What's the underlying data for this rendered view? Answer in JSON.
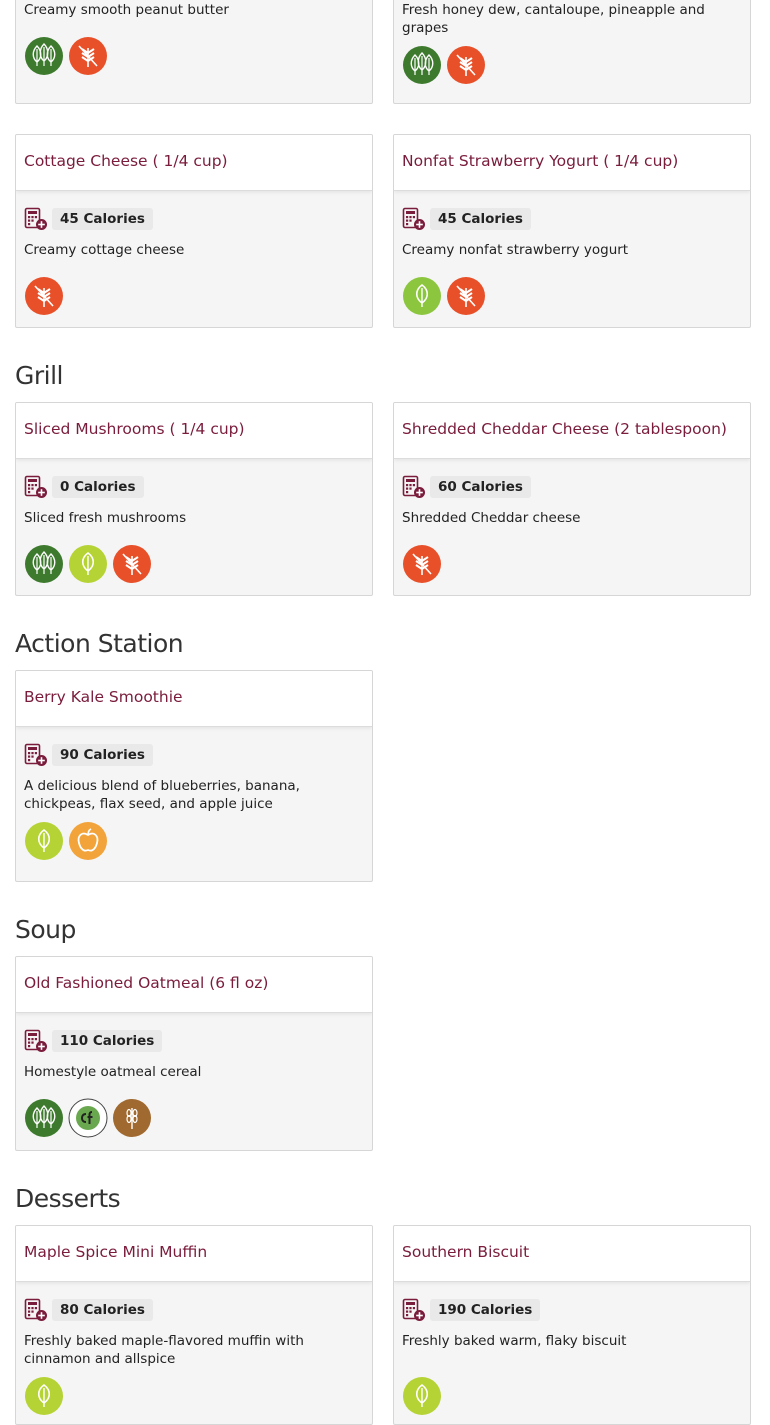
{
  "sections": {
    "grill": {
      "title": "Grill"
    },
    "action_station": {
      "title": "Action Station"
    },
    "soup": {
      "title": "Soup"
    },
    "desserts": {
      "title": "Desserts"
    }
  },
  "items": [
    {
      "name": "",
      "calories": "",
      "description": "Creamy smooth peanut butter",
      "badges": [
        "vegan",
        "no-gluten"
      ]
    },
    {
      "name": "",
      "calories": "",
      "description": "Fresh honey dew, cantaloupe, pineapple and grapes",
      "badges": [
        "vegan",
        "no-gluten"
      ]
    },
    {
      "name": "Cottage Cheese ( 1/4 cup)",
      "calories": "45 Calories",
      "description": "Creamy cottage cheese",
      "badges": [
        "no-gluten"
      ]
    },
    {
      "name": "Nonfat Strawberry Yogurt ( 1/4 cup)",
      "calories": "45 Calories",
      "description": "Creamy nonfat strawberry yogurt",
      "badges": [
        "vegetarian",
        "no-gluten"
      ]
    },
    {
      "name": "Sliced Mushrooms ( 1/4 cup)",
      "calories": "0 Calories",
      "description": "Sliced fresh mushrooms",
      "badges": [
        "vegan",
        "plant-forward",
        "no-gluten"
      ]
    },
    {
      "name": "Shredded Cheddar Cheese (2 tablespoon)",
      "calories": "60 Calories",
      "description": "Shredded Cheddar cheese",
      "badges": [
        "no-gluten"
      ]
    },
    {
      "name": "Berry Kale Smoothie",
      "calories": "90 Calories",
      "description": "A delicious blend of blueberries, banana, chickpeas, flax seed, and apple juice",
      "badges": [
        "plant-forward",
        "eat-well"
      ]
    },
    {
      "name": "Old Fashioned Oatmeal (6 fl oz)",
      "calories": "110 Calories",
      "description": "Homestyle oatmeal cereal",
      "badges": [
        "vegan",
        "low-carbon",
        "whole-grain"
      ]
    },
    {
      "name": "Maple Spice Mini Muffin",
      "calories": "80 Calories",
      "description": "Freshly baked maple-flavored muffin with cinnamon and allspice",
      "badges": [
        "plant-forward"
      ]
    },
    {
      "name": "Southern Biscuit",
      "calories": "190 Calories",
      "description": "Freshly baked warm, flaky biscuit",
      "badges": [
        "plant-forward"
      ]
    }
  ],
  "badge_icons": {
    "vegan": {
      "icon": "vegan-leaf-icon",
      "color": "#3d7a2e",
      "label": "VEGAN"
    },
    "no-gluten": {
      "icon": "no-gluten-wheat-icon",
      "color": "#e8502a",
      "label": "MADE WITHOUT GLUTEN"
    },
    "vegetarian": {
      "icon": "vegetarian-leaf-icon",
      "color": "#8cc63f",
      "label": "VEGETARIAN"
    },
    "plant-forward": {
      "icon": "plant-forward-leaf-icon",
      "color": "#b5d334",
      "label": "PLANT FORWARD"
    },
    "eat-well": {
      "icon": "apple-icon",
      "color": "#f2a33a",
      "label": "EAT WELL"
    },
    "low-carbon": {
      "icon": "low-carbon-icon",
      "color": "#ffffff",
      "label": "LOW CARBON CERTIFIED"
    },
    "whole-grain": {
      "icon": "whole-grain-icon",
      "color": "#a0692f",
      "label": "MADE WITH WHOLE GRAIN"
    }
  },
  "colors": {
    "title": "#7a1c3b",
    "card_bg": "#f5f5f5",
    "card_border": "#d6d6d6"
  }
}
